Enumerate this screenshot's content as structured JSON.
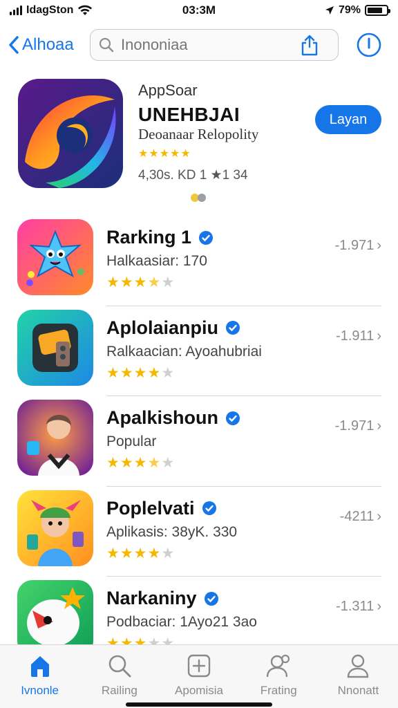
{
  "status": {
    "carrier": "IdagSton",
    "time": "03:3M",
    "battery": "79%"
  },
  "nav": {
    "back_label": "Alhoaa",
    "search_placeholder": "Inononiaa"
  },
  "featured": {
    "kicker": "AppSoar",
    "name": "UNEHBJAI",
    "subtitle": "Deoanaar Relopolity",
    "stars": "★★★★★",
    "meta": "4,30s.   KD 1 ★1 34",
    "get_label": "Layan"
  },
  "apps": [
    {
      "title": "Rarking 1",
      "desc": "Halkaasiar: 170",
      "rank": "-1.971",
      "rating": 3.5
    },
    {
      "title": "Aplolaianpiu",
      "desc": "Ralkaacian: Ayoahubriai",
      "rank": "-1.911",
      "rating": 4
    },
    {
      "title": "Apalkishoun",
      "desc": "Popular",
      "rank": "-1.971",
      "rating": 3.5
    },
    {
      "title": "Poplelvati",
      "desc": "Aplikasis: 38yK. 330",
      "rank": "-4211",
      "rating": 4
    },
    {
      "title": "Narkaniny",
      "desc": "Podbaciar: 1Ayo21 3ao",
      "rank": "-1.311",
      "rating": 3
    }
  ],
  "tabs": [
    {
      "label": "Ivnonle",
      "icon": "home-icon"
    },
    {
      "label": "Railing",
      "icon": "search-icon"
    },
    {
      "label": "Apomisia",
      "icon": "add-square-icon"
    },
    {
      "label": "Frating",
      "icon": "people-icon"
    },
    {
      "label": "Nnonatt",
      "icon": "person-icon"
    }
  ],
  "colors": {
    "accent": "#1676e8",
    "star": "#f5b800"
  }
}
